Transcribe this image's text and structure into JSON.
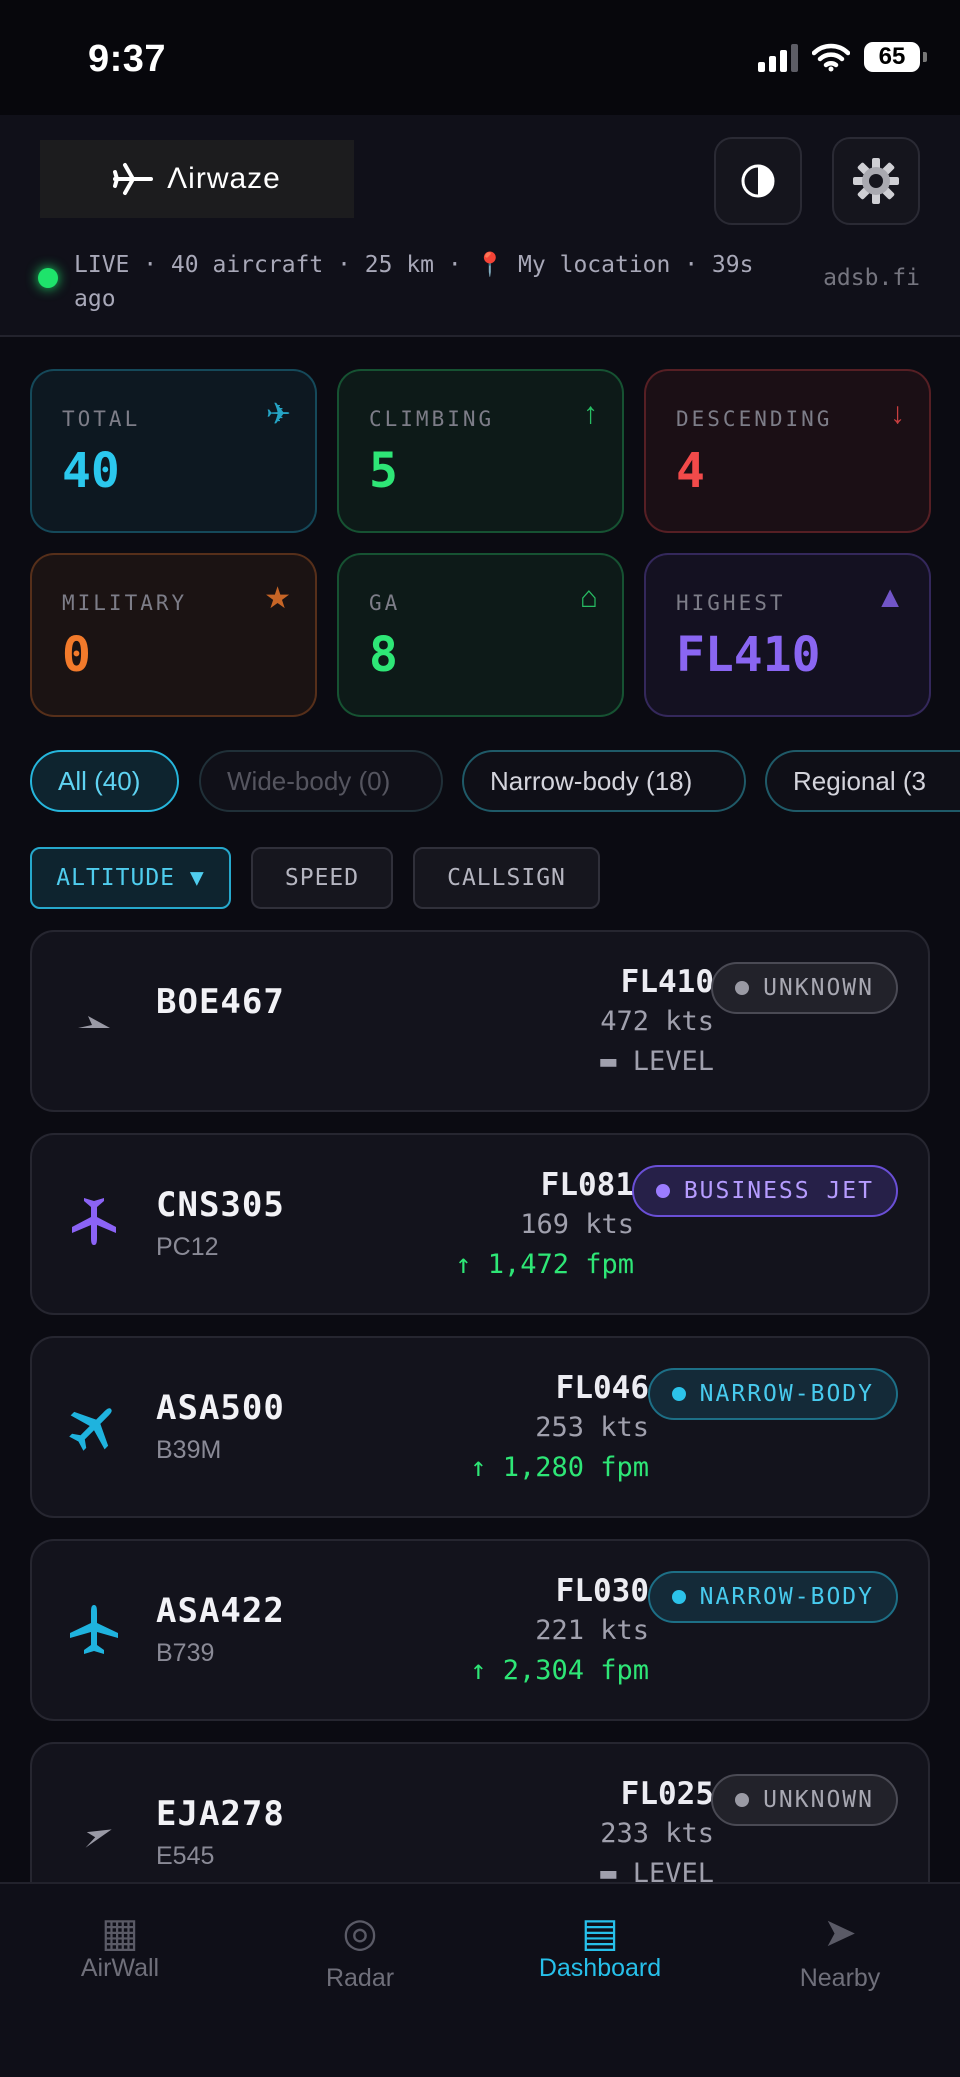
{
  "status_bar": {
    "time": "9:37",
    "battery": "65"
  },
  "header": {
    "app_name": "Λirwaze",
    "theme_icon": "half-circle-icon",
    "settings_icon": "gear-icon",
    "live_text": "LIVE · 40 aircraft · 25 km · 📍 My location · 39s ago",
    "source": "adsb.fi"
  },
  "stats": [
    {
      "label": "TOTAL",
      "value": "40",
      "icon": "✈",
      "color": "#2bc8ee"
    },
    {
      "label": "CLIMBING",
      "value": "5",
      "icon": "↑",
      "color": "#2ee676"
    },
    {
      "label": "DESCENDING",
      "value": "4",
      "icon": "↓",
      "color": "#f24a4a"
    },
    {
      "label": "MILITARY",
      "value": "0",
      "icon": "★",
      "color": "#f27a2b"
    },
    {
      "label": "GA",
      "value": "8",
      "icon": "⌂",
      "color": "#2ee676"
    },
    {
      "label": "HIGHEST",
      "value": "FL410",
      "icon": "▲",
      "color": "#8a66f2"
    }
  ],
  "filters": [
    {
      "label": "All (40)",
      "state": "active"
    },
    {
      "label": "Wide-body (0)",
      "state": "disabled"
    },
    {
      "label": "Narrow-body (18)",
      "state": "normal"
    },
    {
      "label": "Regional (3",
      "state": "normal"
    }
  ],
  "sort": [
    {
      "label": "ALTITUDE ▼",
      "active": true
    },
    {
      "label": "SPEED",
      "active": false
    },
    {
      "label": "CALLSIGN",
      "active": false
    }
  ],
  "aircraft": [
    {
      "callsign": "BOE467",
      "type": "",
      "fl": "FL410",
      "speed": "472 kts",
      "vs": "▬ LEVEL",
      "vs_dir": "level",
      "badge": "UNKNOWN",
      "category": "unknown",
      "icon": "arrow-icon"
    },
    {
      "callsign": "CNS305",
      "type": "PC12",
      "fl": "FL081",
      "speed": "169 kts",
      "vs": "↑ 1,472 fpm",
      "vs_dir": "up",
      "badge": "BUSINESS JET",
      "category": "business",
      "icon": "business-jet-icon"
    },
    {
      "callsign": "ASA500",
      "type": "B39M",
      "fl": "FL046",
      "speed": "253 kts",
      "vs": "↑ 1,280 fpm",
      "vs_dir": "up",
      "badge": "NARROW-BODY",
      "category": "narrow",
      "icon": "airliner-icon"
    },
    {
      "callsign": "ASA422",
      "type": "B739",
      "fl": "FL030",
      "speed": "221 kts",
      "vs": "↑ 2,304 fpm",
      "vs_dir": "up",
      "badge": "NARROW-BODY",
      "category": "narrow",
      "icon": "airliner-icon"
    },
    {
      "callsign": "EJA278",
      "type": "E545",
      "fl": "FL025",
      "speed": "233 kts",
      "vs": "▬ LEVEL",
      "vs_dir": "level",
      "badge": "UNKNOWN",
      "category": "unknown",
      "icon": "arrow-icon"
    }
  ],
  "tabs": [
    {
      "label": "AirWall",
      "icon": "▦",
      "active": false
    },
    {
      "label": "Radar",
      "icon": "◎",
      "active": false
    },
    {
      "label": "Dashboard",
      "icon": "▤",
      "active": true
    },
    {
      "label": "Nearby",
      "icon": "➤",
      "active": false
    }
  ]
}
